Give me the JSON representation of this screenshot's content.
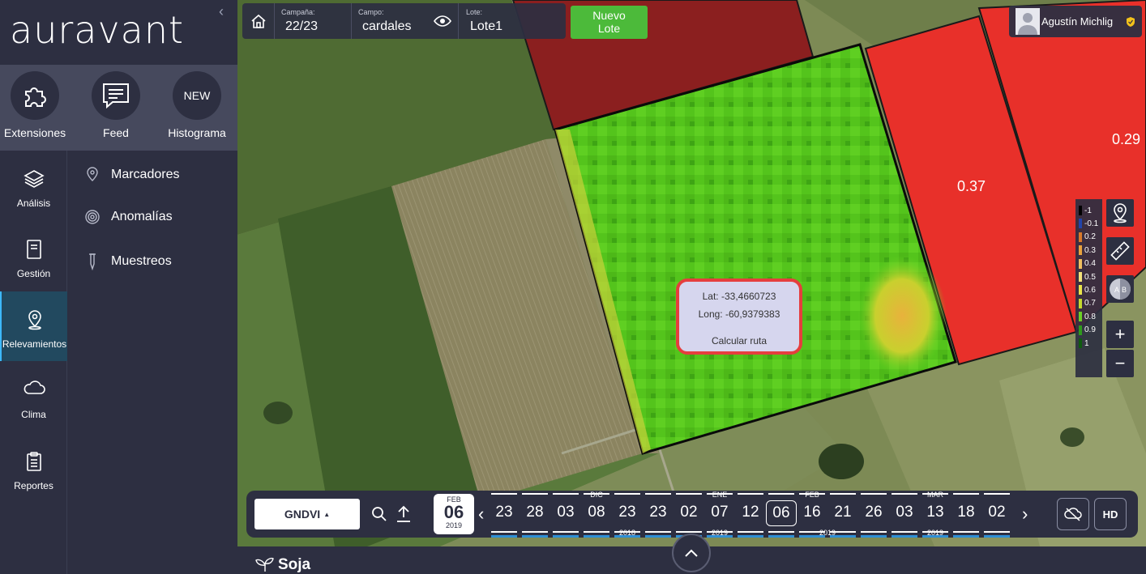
{
  "app": {
    "logo": "auravant"
  },
  "quick_actions": [
    {
      "label": "Extensiones",
      "icon": "puzzle-icon"
    },
    {
      "label": "Feed",
      "icon": "chat-icon"
    },
    {
      "label": "Histograma",
      "badge": "NEW"
    }
  ],
  "nav": [
    {
      "label": "Análisis",
      "icon": "layers-icon"
    },
    {
      "label": "Gestión",
      "icon": "notebook-icon"
    },
    {
      "label": "Relevamientos",
      "icon": "location-pin-icon",
      "active": true
    },
    {
      "label": "Clima",
      "icon": "cloud-icon"
    },
    {
      "label": "Reportes",
      "icon": "clipboard-icon"
    }
  ],
  "submenu": [
    {
      "label": "Marcadores",
      "icon": "marker-icon"
    },
    {
      "label": "Anomalías",
      "icon": "anomaly-icon"
    },
    {
      "label": "Muestreos",
      "icon": "sample-icon"
    }
  ],
  "topbar": {
    "campaign_caption": "Campaña:",
    "campaign_value": "22/23",
    "field_caption": "Campo:",
    "field_value": "cardales",
    "lot_caption": "Lote:",
    "lot_value": "Lote1",
    "new_lot_label": "Nuevo Lote"
  },
  "user": {
    "name": "Agustín Michlig"
  },
  "map_labels": {
    "value_a": "0.37",
    "value_b": "0.29"
  },
  "popup": {
    "lat": "Lat: -33,4660723",
    "long": "Long: -60,9379383",
    "action": "Calcular ruta"
  },
  "legend": [
    {
      "label": "-1",
      "color": "#000000"
    },
    {
      "label": "-0.1",
      "color": "#2244aa"
    },
    {
      "label": "0.2",
      "color": "#d9792a"
    },
    {
      "label": "0.3",
      "color": "#e8a23d"
    },
    {
      "label": "0.4",
      "color": "#f0c060"
    },
    {
      "label": "0.5",
      "color": "#f3e27a"
    },
    {
      "label": "0.6",
      "color": "#e9e44a"
    },
    {
      "label": "0.7",
      "color": "#c5d92e"
    },
    {
      "label": "0.8",
      "color": "#6ccf25"
    },
    {
      "label": "0.9",
      "color": "#2f9a1c"
    },
    {
      "label": "1",
      "color": "#0f5b10"
    }
  ],
  "tools": {
    "zoom_in": "+",
    "zoom_out": "−"
  },
  "timeline": {
    "index": "GNDVI",
    "current": {
      "month": "FEB",
      "day": "06",
      "year": "2019"
    },
    "dates": [
      "23",
      "28",
      "03",
      "08",
      "23",
      "23",
      "02",
      "07",
      "12",
      "06",
      "16",
      "21",
      "26",
      "03",
      "13",
      "18",
      "02"
    ],
    "selected_index": 9,
    "months": [
      "DIC",
      "ENE",
      "FEB",
      "MAR"
    ],
    "years": [
      "2018",
      "2019",
      "2019",
      "2019"
    ],
    "hd": "HD"
  },
  "crop": {
    "name": "Soja"
  }
}
